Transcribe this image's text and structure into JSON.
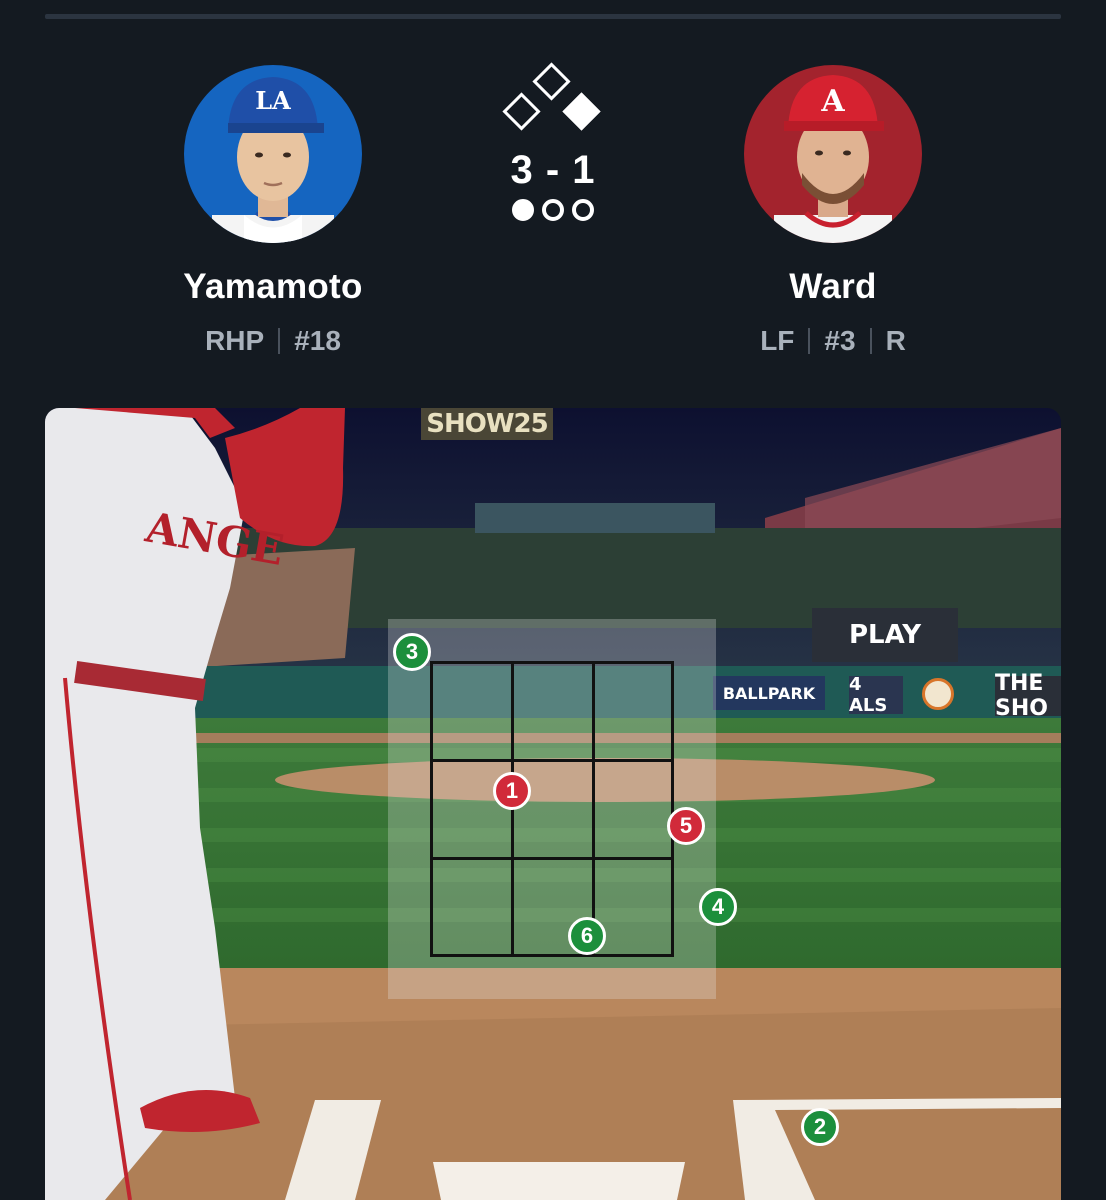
{
  "pitcher": {
    "name": "Yamamoto",
    "position": "RHP",
    "number": "#18",
    "cap_logo": "LA"
  },
  "batter": {
    "name": "Ward",
    "position": "LF",
    "number": "#3",
    "bats": "R",
    "cap_logo": "A"
  },
  "game_state": {
    "count": "3 - 1",
    "bases": {
      "first": true,
      "second": false,
      "third": false
    },
    "outs": 1
  },
  "scene": {
    "signs": {
      "show": "SHOW25",
      "mlb_play": "PLAY",
      "ballpark": "BALLPARK",
      "als": "4 ALS",
      "the_show": "THE SHO"
    },
    "jersey_text": "ANGE"
  },
  "pitches": [
    {
      "label": "1",
      "result": "strike"
    },
    {
      "label": "2",
      "result": "ball"
    },
    {
      "label": "3",
      "result": "ball"
    },
    {
      "label": "4",
      "result": "ball"
    },
    {
      "label": "5",
      "result": "strike"
    },
    {
      "label": "6",
      "result": "ball"
    }
  ],
  "colors": {
    "background": "#141a21",
    "ball": "#1c8f3c",
    "strike": "#d12a3a",
    "dodgers_blue": "#1565c0",
    "angels_red": "#a3232d"
  }
}
